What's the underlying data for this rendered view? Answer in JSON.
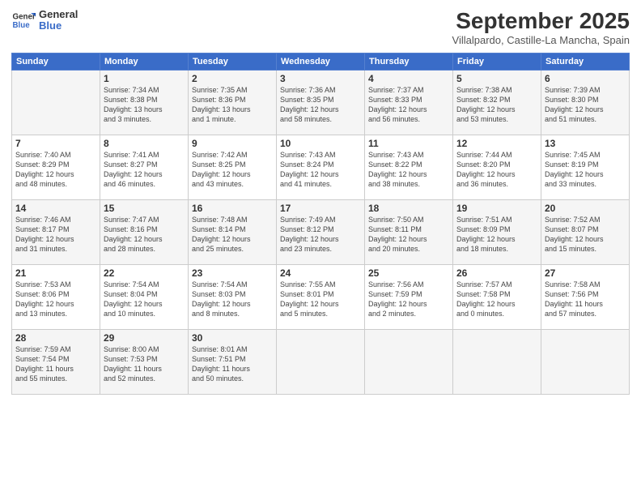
{
  "header": {
    "logo_line1": "General",
    "logo_line2": "Blue",
    "month": "September 2025",
    "location": "Villalpardo, Castille-La Mancha, Spain"
  },
  "days_of_week": [
    "Sunday",
    "Monday",
    "Tuesday",
    "Wednesday",
    "Thursday",
    "Friday",
    "Saturday"
  ],
  "weeks": [
    [
      {
        "day": "",
        "info": ""
      },
      {
        "day": "1",
        "info": "Sunrise: 7:34 AM\nSunset: 8:38 PM\nDaylight: 13 hours\nand 3 minutes."
      },
      {
        "day": "2",
        "info": "Sunrise: 7:35 AM\nSunset: 8:36 PM\nDaylight: 13 hours\nand 1 minute."
      },
      {
        "day": "3",
        "info": "Sunrise: 7:36 AM\nSunset: 8:35 PM\nDaylight: 12 hours\nand 58 minutes."
      },
      {
        "day": "4",
        "info": "Sunrise: 7:37 AM\nSunset: 8:33 PM\nDaylight: 12 hours\nand 56 minutes."
      },
      {
        "day": "5",
        "info": "Sunrise: 7:38 AM\nSunset: 8:32 PM\nDaylight: 12 hours\nand 53 minutes."
      },
      {
        "day": "6",
        "info": "Sunrise: 7:39 AM\nSunset: 8:30 PM\nDaylight: 12 hours\nand 51 minutes."
      }
    ],
    [
      {
        "day": "7",
        "info": "Sunrise: 7:40 AM\nSunset: 8:29 PM\nDaylight: 12 hours\nand 48 minutes."
      },
      {
        "day": "8",
        "info": "Sunrise: 7:41 AM\nSunset: 8:27 PM\nDaylight: 12 hours\nand 46 minutes."
      },
      {
        "day": "9",
        "info": "Sunrise: 7:42 AM\nSunset: 8:25 PM\nDaylight: 12 hours\nand 43 minutes."
      },
      {
        "day": "10",
        "info": "Sunrise: 7:43 AM\nSunset: 8:24 PM\nDaylight: 12 hours\nand 41 minutes."
      },
      {
        "day": "11",
        "info": "Sunrise: 7:43 AM\nSunset: 8:22 PM\nDaylight: 12 hours\nand 38 minutes."
      },
      {
        "day": "12",
        "info": "Sunrise: 7:44 AM\nSunset: 8:20 PM\nDaylight: 12 hours\nand 36 minutes."
      },
      {
        "day": "13",
        "info": "Sunrise: 7:45 AM\nSunset: 8:19 PM\nDaylight: 12 hours\nand 33 minutes."
      }
    ],
    [
      {
        "day": "14",
        "info": "Sunrise: 7:46 AM\nSunset: 8:17 PM\nDaylight: 12 hours\nand 31 minutes."
      },
      {
        "day": "15",
        "info": "Sunrise: 7:47 AM\nSunset: 8:16 PM\nDaylight: 12 hours\nand 28 minutes."
      },
      {
        "day": "16",
        "info": "Sunrise: 7:48 AM\nSunset: 8:14 PM\nDaylight: 12 hours\nand 25 minutes."
      },
      {
        "day": "17",
        "info": "Sunrise: 7:49 AM\nSunset: 8:12 PM\nDaylight: 12 hours\nand 23 minutes."
      },
      {
        "day": "18",
        "info": "Sunrise: 7:50 AM\nSunset: 8:11 PM\nDaylight: 12 hours\nand 20 minutes."
      },
      {
        "day": "19",
        "info": "Sunrise: 7:51 AM\nSunset: 8:09 PM\nDaylight: 12 hours\nand 18 minutes."
      },
      {
        "day": "20",
        "info": "Sunrise: 7:52 AM\nSunset: 8:07 PM\nDaylight: 12 hours\nand 15 minutes."
      }
    ],
    [
      {
        "day": "21",
        "info": "Sunrise: 7:53 AM\nSunset: 8:06 PM\nDaylight: 12 hours\nand 13 minutes."
      },
      {
        "day": "22",
        "info": "Sunrise: 7:54 AM\nSunset: 8:04 PM\nDaylight: 12 hours\nand 10 minutes."
      },
      {
        "day": "23",
        "info": "Sunrise: 7:54 AM\nSunset: 8:03 PM\nDaylight: 12 hours\nand 8 minutes."
      },
      {
        "day": "24",
        "info": "Sunrise: 7:55 AM\nSunset: 8:01 PM\nDaylight: 12 hours\nand 5 minutes."
      },
      {
        "day": "25",
        "info": "Sunrise: 7:56 AM\nSunset: 7:59 PM\nDaylight: 12 hours\nand 2 minutes."
      },
      {
        "day": "26",
        "info": "Sunrise: 7:57 AM\nSunset: 7:58 PM\nDaylight: 12 hours\nand 0 minutes."
      },
      {
        "day": "27",
        "info": "Sunrise: 7:58 AM\nSunset: 7:56 PM\nDaylight: 11 hours\nand 57 minutes."
      }
    ],
    [
      {
        "day": "28",
        "info": "Sunrise: 7:59 AM\nSunset: 7:54 PM\nDaylight: 11 hours\nand 55 minutes."
      },
      {
        "day": "29",
        "info": "Sunrise: 8:00 AM\nSunset: 7:53 PM\nDaylight: 11 hours\nand 52 minutes."
      },
      {
        "day": "30",
        "info": "Sunrise: 8:01 AM\nSunset: 7:51 PM\nDaylight: 11 hours\nand 50 minutes."
      },
      {
        "day": "",
        "info": ""
      },
      {
        "day": "",
        "info": ""
      },
      {
        "day": "",
        "info": ""
      },
      {
        "day": "",
        "info": ""
      }
    ]
  ]
}
